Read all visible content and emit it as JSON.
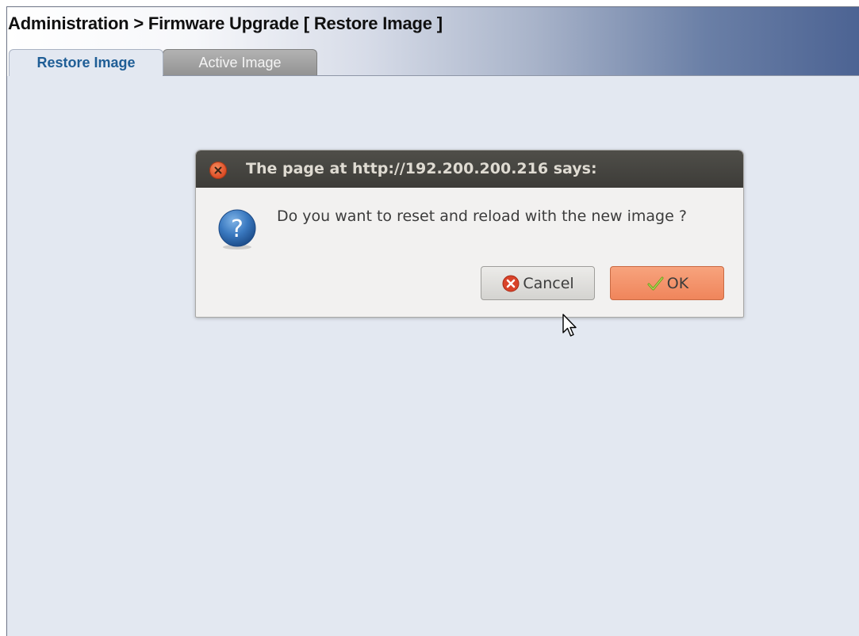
{
  "header": {
    "title": "Administration > Firmware Upgrade [ Restore Image ]"
  },
  "tabs": [
    {
      "label": "Restore Image",
      "selected": true
    },
    {
      "label": "Active Image",
      "selected": false
    }
  ],
  "dialog": {
    "title": "The page at http://192.200.200.216 says:",
    "message": "Do you want to reset and reload with the new image ?",
    "cancel_label": "Cancel",
    "ok_label": "OK"
  },
  "icons": {
    "dialog_close": "close-icon",
    "message": "question-icon",
    "cancel": "cancel-icon",
    "ok": "checkmark-icon",
    "pointer": "mouse-cursor-icon"
  },
  "colors": {
    "page_background": "#e3e8f1",
    "header_gradient_end": "#4c6393",
    "selected_tab_text": "#1f5e96",
    "dialog_titlebar": "#3d3c38",
    "ok_button": "#f0855b"
  }
}
